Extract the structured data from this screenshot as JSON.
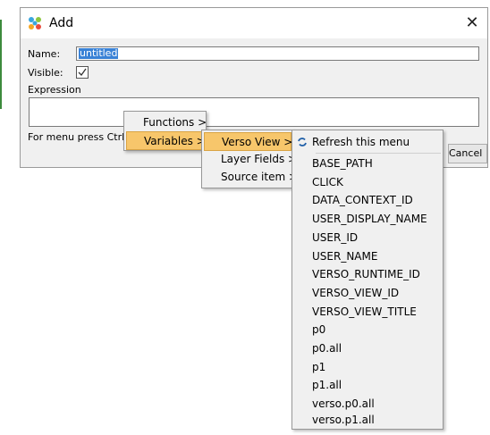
{
  "dialog": {
    "title": "Add",
    "close_glyph": "✕",
    "name_label": "Name:",
    "name_value": "untitled",
    "visible_label": "Visible:",
    "visible_checked": true,
    "expression_label": "Expression",
    "hint": "For menu press Ctrl+S",
    "cancel_label": "Cancel"
  },
  "menu1": {
    "items": [
      {
        "label": "Functions >",
        "highlighted": false
      },
      {
        "label": "Variables >",
        "highlighted": true
      }
    ]
  },
  "menu2": {
    "items": [
      {
        "label": "Verso View >",
        "highlighted": true
      },
      {
        "label": "Layer Fields >",
        "highlighted": false
      },
      {
        "label": "Source item >",
        "highlighted": false
      }
    ]
  },
  "menu3": {
    "refresh_label": "Refresh this menu",
    "refresh_icon": "refresh-icon",
    "items": [
      "BASE_PATH",
      "CLICK",
      "DATA_CONTEXT_ID",
      "USER_DISPLAY_NAME",
      "USER_ID",
      "USER_NAME",
      "VERSO_RUNTIME_ID",
      "VERSO_VIEW_ID",
      "VERSO_VIEW_TITLE",
      "p0",
      "p0.all",
      "p1",
      "p1.all",
      "verso.p0.all",
      "verso.p1.all"
    ]
  },
  "colors": {
    "highlight": "#f7c66b",
    "selection": "#3a82d6",
    "menu_bg": "#f0f0f0"
  }
}
